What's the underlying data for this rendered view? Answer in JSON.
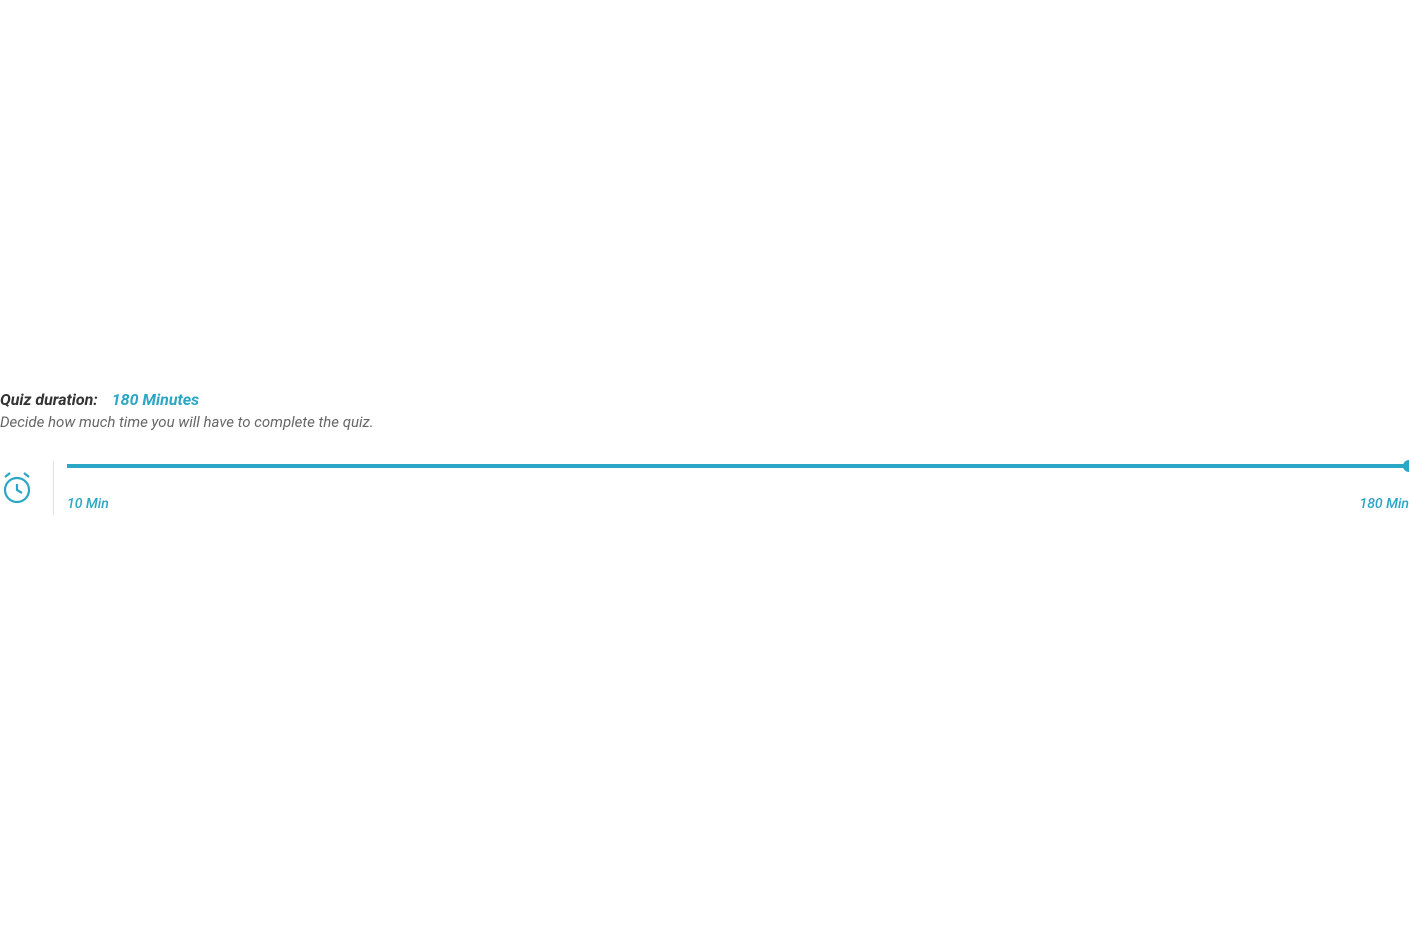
{
  "duration": {
    "label": "Quiz duration:",
    "value": "180 Minutes",
    "description": "Decide how much time you will have to complete the quiz."
  },
  "slider": {
    "minLabel": "10 Min",
    "maxLabel": "180 Min",
    "min": 10,
    "max": 180,
    "current": 180
  },
  "colors": {
    "accent": "#2aa7c4"
  }
}
